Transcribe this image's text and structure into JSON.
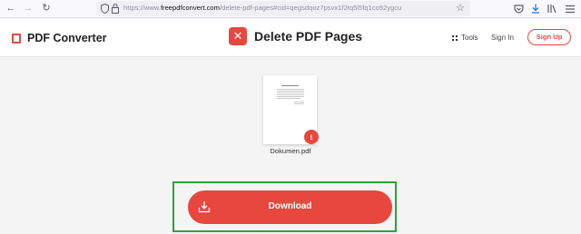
{
  "browser": {
    "url_prefix": "https://www.",
    "url_host": "freepdfconvert.com",
    "url_path": "/delete-pdf-pages#cid=qegsdqoz7psvx1f2tq5l5fq1co92ygcu"
  },
  "header": {
    "brand": "PDF Converter",
    "tool_title": "Delete PDF Pages",
    "tools_label": "Tools",
    "sign_in": "Sign In",
    "sign_up": "Sign Up"
  },
  "file": {
    "name": "Dokumen.pdf"
  },
  "download": {
    "label": "Download"
  },
  "colors": {
    "accent": "#e8473e",
    "highlight_frame": "#2aa43a"
  }
}
